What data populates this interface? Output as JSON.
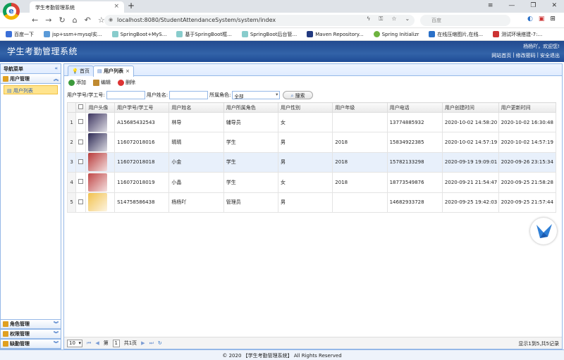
{
  "browser": {
    "tab_title": "学生考勤管理系统",
    "url": "localhost:8080/StudentAttendanceSystem/system/index",
    "search_placeholder": "百度",
    "bookmarks": [
      "百度一下",
      "jsp+ssm+mysql实...",
      "SpringBoot+MyS...",
      "基于SpringBoot框...",
      "SpringBoot后台管...",
      "Maven Repository...",
      "Spring Initializr",
      "在线压缩图片,在线...",
      "测试环境搭建-7:..."
    ]
  },
  "header": {
    "title": "学生考勤管理系统",
    "welcome": "杨杨吖，欢迎您!",
    "links": [
      "网站首页",
      "|",
      "修改密码",
      "|",
      "安全退出"
    ]
  },
  "sidebar": {
    "title": "导航菜单",
    "panels": [
      {
        "label": "用户管理",
        "items": [
          "用户列表"
        ]
      },
      {
        "label": "角色管理"
      },
      {
        "label": "权限管理"
      },
      {
        "label": "缺勤管理"
      }
    ]
  },
  "tabs": [
    "首页",
    "用户列表"
  ],
  "toolbar": {
    "add": "添加",
    "edit": "编辑",
    "delete": "删除"
  },
  "filter": {
    "id_label": "用户学号/学工号:",
    "name_label": "用户姓名:",
    "role_label": "所属角色:",
    "role_value": "全部",
    "search_button": "搜索"
  },
  "table": {
    "headers": [
      "用户头像",
      "用户学号/学工号",
      "用户姓名",
      "用户所属角色",
      "用户性别",
      "用户年级",
      "用户电话",
      "用户创建时间",
      "用户更新时间"
    ],
    "rows": [
      {
        "n": "1",
        "id": "A15685432543",
        "name": "林导",
        "role": "辅导员",
        "sex": "女",
        "grade": "",
        "phone": "13774885932",
        "created": "2020-10-02 14:58:20",
        "updated": "2020-10-02 16:30:48",
        "avatar_color": "#3d3560"
      },
      {
        "n": "2",
        "id": "116072018016",
        "name": "晴晴",
        "role": "学生",
        "sex": "男",
        "grade": "2018",
        "phone": "15834922385",
        "created": "2020-10-02 14:57:19",
        "updated": "2020-10-02 14:57:19",
        "avatar_color": "#2e2a55"
      },
      {
        "n": "3",
        "id": "116072018018",
        "name": "小金",
        "role": "学生",
        "sex": "男",
        "grade": "2018",
        "phone": "15782133298",
        "created": "2020-09-19 19:09:01",
        "updated": "2020-09-26 23:15:34",
        "avatar_color": "#b83a3a"
      },
      {
        "n": "4",
        "id": "116072018019",
        "name": "小晶",
        "role": "学生",
        "sex": "女",
        "grade": "2018",
        "phone": "18773549876",
        "created": "2020-09-21 21:54:47",
        "updated": "2020-09-25 21:58:28",
        "avatar_color": "#c04848"
      },
      {
        "n": "5",
        "id": "S14758586438",
        "name": "杨杨吖",
        "role": "管理员",
        "sex": "男",
        "grade": "",
        "phone": "14682933728",
        "created": "2020-09-25 19:42:03",
        "updated": "2020-09-25 21:57:44",
        "avatar_color": "#f2c14e"
      }
    ]
  },
  "pager": {
    "page_size": "10",
    "page_prefix": "第",
    "page_number": "1",
    "page_suffix": "共1页",
    "info": "显示1到5,共5记录"
  },
  "footer": "© 2020 【学生考勤管理系统】 All Rights Reserved",
  "colors": {
    "header": "#2a5aa0",
    "accent": "#95b8e7",
    "highlight": "#ffe48d"
  }
}
